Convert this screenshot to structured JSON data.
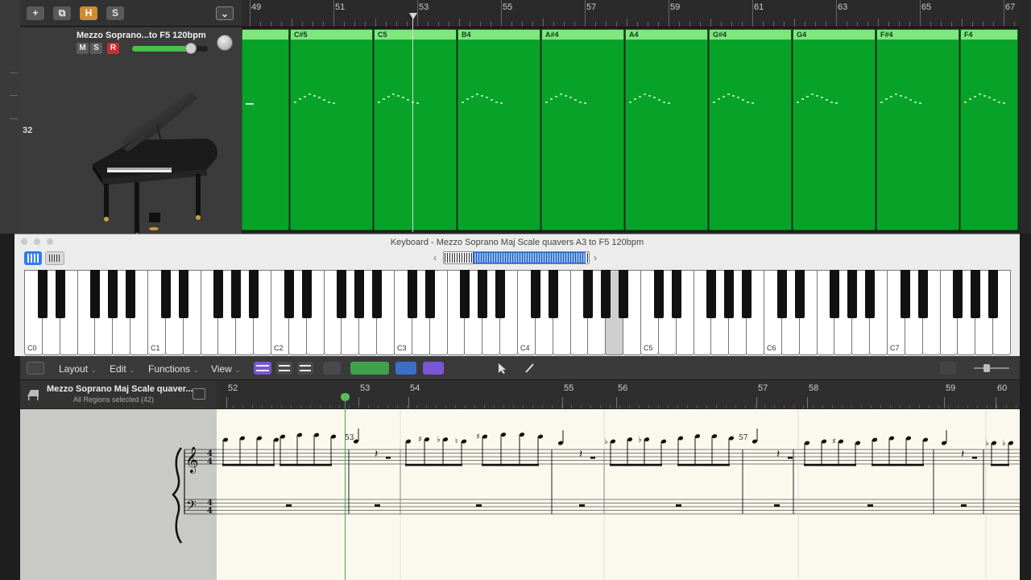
{
  "tracks_area": {
    "toolbar": {
      "add": "+",
      "duplicate": "⧉",
      "hide": "H",
      "solo_lock": "S",
      "menu": "⌄"
    },
    "track": {
      "number": "32",
      "name": "Mezzo Soprano...to F5  120bpm",
      "mute": "M",
      "solo": "S",
      "record": "R",
      "volume_level": 0.8,
      "icon": "grand-piano-icon"
    },
    "ruler": {
      "bars": [
        "49",
        "51",
        "53",
        "55",
        "57",
        "59",
        "61",
        "63",
        "65",
        "67"
      ]
    },
    "regions": [
      {
        "label": ""
      },
      {
        "label": "C#5"
      },
      {
        "label": "C5"
      },
      {
        "label": "B4"
      },
      {
        "label": "A#4"
      },
      {
        "label": "A4"
      },
      {
        "label": "G#4"
      },
      {
        "label": "G4"
      },
      {
        "label": "F#4"
      },
      {
        "label": "F4"
      }
    ],
    "region_color": "#06a328"
  },
  "keyboard_window": {
    "title": "Keyboard - Mezzo Soprano Maj Scale quavers A3 to F5  120bpm",
    "octave_labels": [
      "C0",
      "C1",
      "C2",
      "C3",
      "C4",
      "C5",
      "C6",
      "C7"
    ],
    "pressed_key_note": "A4"
  },
  "score_editor": {
    "menus": [
      {
        "label": "Layout"
      },
      {
        "label": "Edit"
      },
      {
        "label": "Functions"
      },
      {
        "label": "View"
      }
    ],
    "header": {
      "title": "Mezzo Soprano Maj Scale quaver...",
      "subtitle": "All Regions selected (42)"
    },
    "ruler": {
      "bars": [
        "52",
        "53",
        "54",
        "55",
        "56",
        "57",
        "58",
        "59",
        "60"
      ]
    },
    "measure_numbers": [
      "53",
      "57"
    ],
    "colors": {
      "paper": "#fbf9ee",
      "playhead": "#4aa04a",
      "accent_purple": "#7a55d8"
    }
  }
}
